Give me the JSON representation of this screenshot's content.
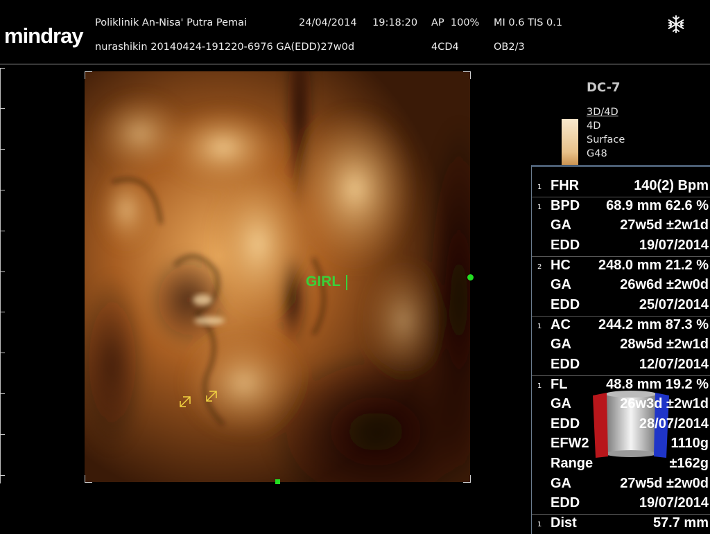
{
  "brand": "mindray",
  "header": {
    "facility": "Poliklinik An-Nisa' Putra Pemai",
    "date": "24/04/2014",
    "time": "19:18:20",
    "ap": "AP  100%",
    "mi_tis": "MI 0.6 TIS 0.1",
    "patient_id": "nurashikin 20140424-191220-6976 GA(EDD)27w0d",
    "preset": "4CD4",
    "exam": "OB2/3",
    "freeze_icon": "snowflake-icon"
  },
  "image": {
    "annotation": "GIRL",
    "annotation_color": "#39d13a",
    "tone_palette": [
      "#2a1204",
      "#7a3f14",
      "#c0782f",
      "#f0c27e"
    ]
  },
  "probe": {
    "name": "DC-7",
    "modes": [
      "3D/4D",
      "4D",
      "Surface",
      "G48"
    ]
  },
  "measurements": [
    {
      "num": "1",
      "label": "FHR",
      "value": "140(2) Bpm"
    },
    {
      "num": "1",
      "label": "BPD",
      "value": "68.9 mm 62.6 %"
    },
    {
      "num": "",
      "label": "GA",
      "value": "27w5d ±2w1d"
    },
    {
      "num": "",
      "label": "EDD",
      "value": "19/07/2014"
    },
    {
      "num": "2",
      "label": "HC",
      "value": "248.0 mm 21.2 %"
    },
    {
      "num": "",
      "label": "GA",
      "value": "26w6d ±2w0d"
    },
    {
      "num": "",
      "label": "EDD",
      "value": "25/07/2014"
    },
    {
      "num": "1",
      "label": "AC",
      "value": "244.2 mm 87.3 %"
    },
    {
      "num": "",
      "label": "GA",
      "value": "28w5d ±2w1d"
    },
    {
      "num": "",
      "label": "EDD",
      "value": "12/07/2014"
    },
    {
      "num": "1",
      "label": "FL",
      "value": "48.8 mm 19.2 %"
    },
    {
      "num": "",
      "label": "GA",
      "value": "26w3d ±2w1d"
    },
    {
      "num": "",
      "label": "EDD",
      "value": "28/07/2014"
    },
    {
      "num": "",
      "label": "EFW2",
      "value": "1110g"
    },
    {
      "num": "",
      "label": "Range",
      "value": "±162g"
    },
    {
      "num": "",
      "label": "GA",
      "value": "27w5d ±2w0d"
    },
    {
      "num": "",
      "label": "EDD",
      "value": "19/07/2014"
    },
    {
      "num": "1",
      "label": "Dist",
      "value": "57.7 mm"
    }
  ]
}
